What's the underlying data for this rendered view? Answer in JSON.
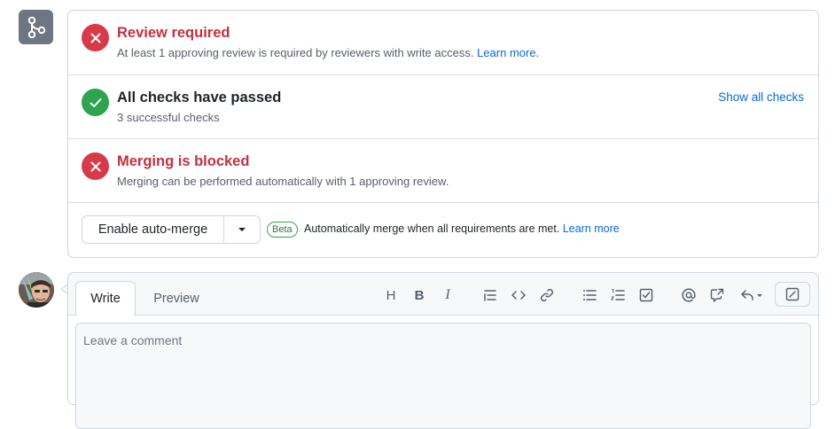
{
  "merge_box": {
    "review": {
      "title": "Review required",
      "subtitle": "At least 1 approving review is required by reviewers with write access.",
      "link": "Learn more."
    },
    "checks": {
      "title": "All checks have passed",
      "subtitle": "3 successful checks",
      "show_all": "Show all checks"
    },
    "blocked": {
      "title": "Merging is blocked",
      "subtitle": "Merging can be performed automatically with 1 approving review."
    },
    "auto_merge": {
      "button_label": "Enable auto-merge",
      "beta_label": "Beta",
      "description": "Automatically merge when all requirements are met.",
      "link": "Learn more"
    }
  },
  "comment": {
    "tabs": [
      "Write",
      "Preview"
    ],
    "placeholder": "Leave a comment",
    "toolbar": {
      "heading": "H",
      "bold": "B",
      "italic": "I"
    }
  },
  "colors": {
    "fail": "#d73a49",
    "success": "#2da44e",
    "link": "#0969da",
    "muted": "#57606a"
  }
}
